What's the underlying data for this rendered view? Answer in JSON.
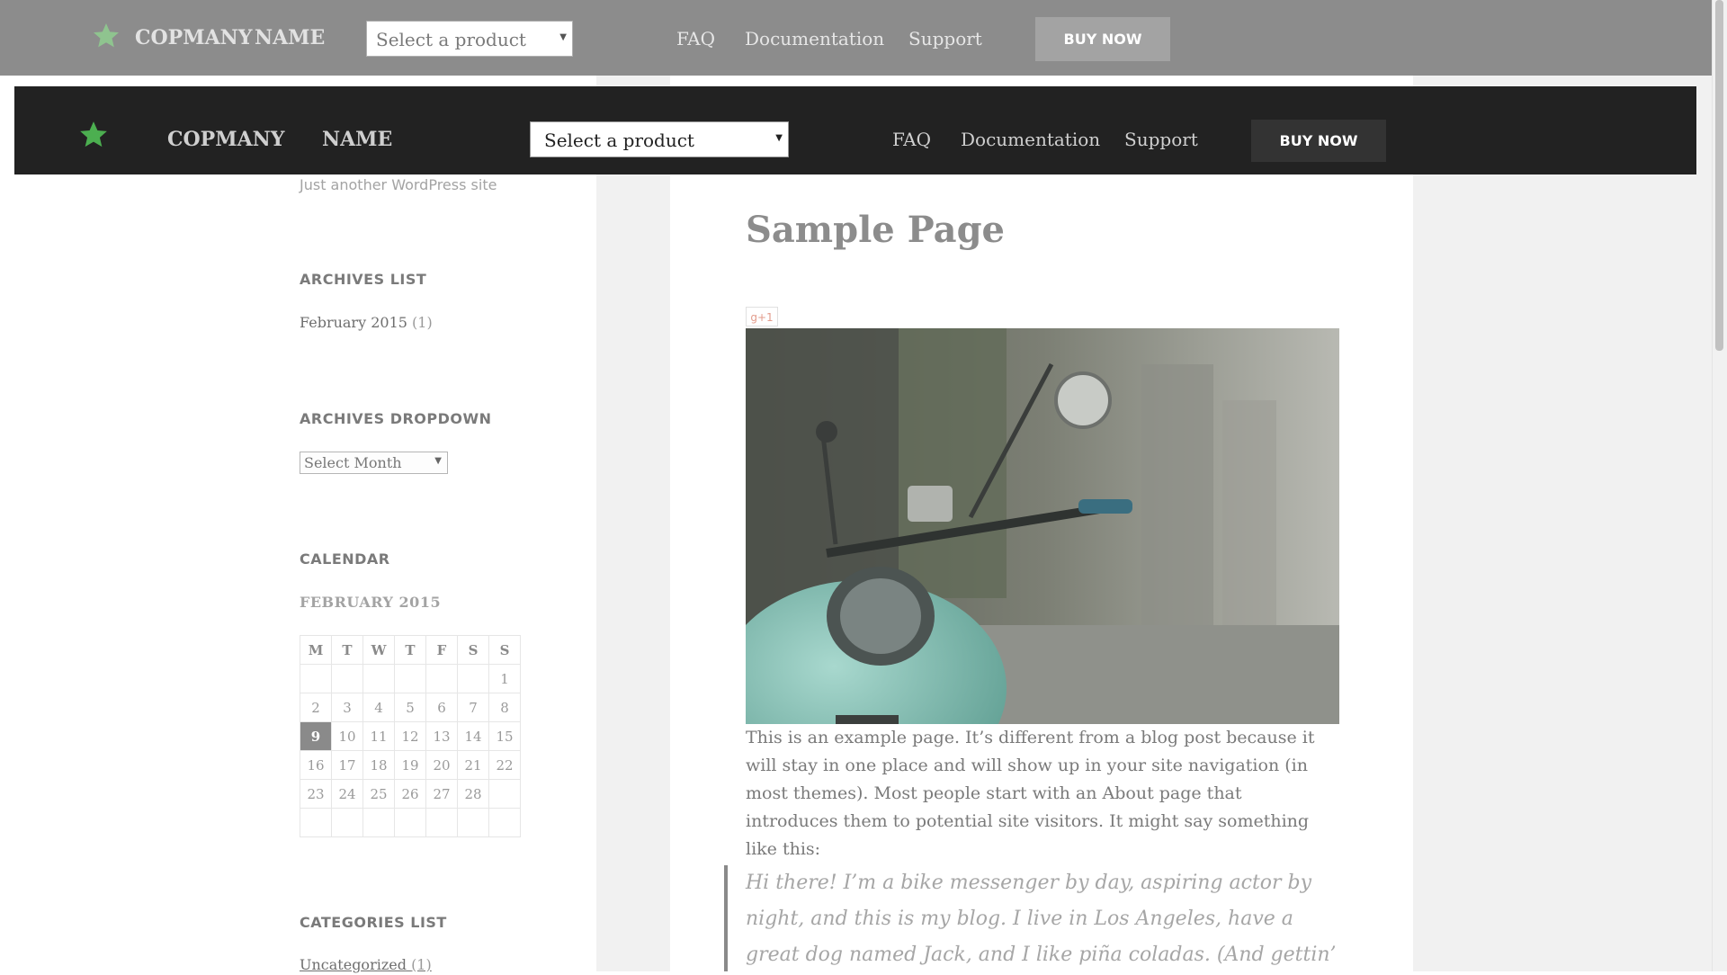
{
  "topbar": {
    "brand_word1": "COPMANY",
    "brand_word2": "NAME",
    "product_select": "Select a product",
    "nav": [
      "FAQ",
      "Documentation",
      "Support"
    ],
    "buy_label": "BUY NOW",
    "star_color": "#8fc48f"
  },
  "header": {
    "brand_word1": "COPMANY",
    "brand_word2": "NAME",
    "product_select": "Select a product",
    "nav": [
      "FAQ",
      "Documentation",
      "Support"
    ],
    "buy_label": "BUY NOW",
    "star_color": "#4caf50"
  },
  "sidebar": {
    "tagline": "Just another WordPress site",
    "archives_list_title": "ARCHIVES LIST",
    "archives_list_item": "February 2015",
    "archives_list_count": "(1)",
    "archives_dropdown_title": "ARCHIVES DROPDOWN",
    "archives_dropdown_value": "Select Month",
    "calendar_title": "CALENDAR",
    "calendar_caption": "FEBRUARY 2015",
    "calendar_days": [
      "M",
      "T",
      "W",
      "T",
      "F",
      "S",
      "S"
    ],
    "calendar_weeks": [
      [
        "",
        "",
        "",
        "",
        "",
        "",
        "1"
      ],
      [
        "2",
        "3",
        "4",
        "5",
        "6",
        "7",
        "8"
      ],
      [
        "9",
        "10",
        "11",
        "12",
        "13",
        "14",
        "15"
      ],
      [
        "16",
        "17",
        "18",
        "19",
        "20",
        "21",
        "22"
      ],
      [
        "23",
        "24",
        "25",
        "26",
        "27",
        "28",
        ""
      ],
      [
        "",
        "",
        "",
        "",
        "",
        "",
        ""
      ]
    ],
    "calendar_today": "9",
    "categories_title": "CATEGORIES LIST",
    "categories_item": "Uncategorized",
    "categories_count": "(1)"
  },
  "main": {
    "title": "Sample Page",
    "gplus_label": "g+1",
    "body": "This is an example page. It’s different from a blog post because it will stay in one place and will show up in your site navigation (in most themes). Most people start with an About page that introduces them to potential site visitors. It might say something like this:",
    "quote": "Hi there! I’m a bike messenger by day, aspiring actor by night, and this is my blog. I live in Los Angeles, have a great dog named Jack, and I like piña coladas. (And gettin’ caught in the"
  }
}
